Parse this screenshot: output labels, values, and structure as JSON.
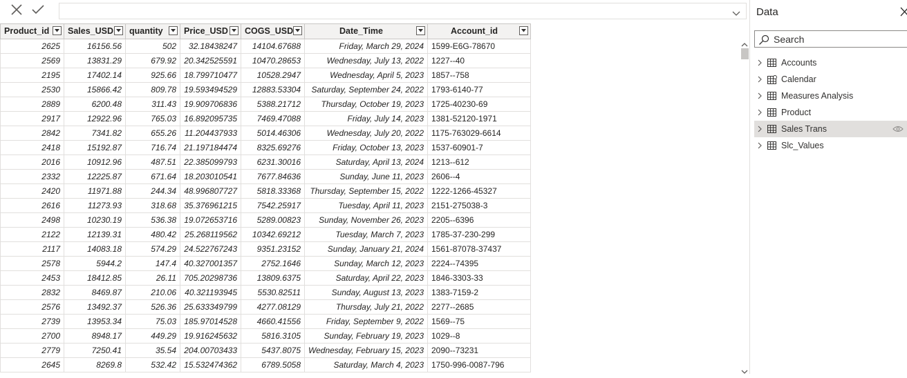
{
  "data_pane": {
    "title": "Data",
    "search_placeholder": "Search",
    "items": [
      {
        "label": "Accounts",
        "icon": "table-icon",
        "selected": false
      },
      {
        "label": "Calendar",
        "icon": "calendar-table-icon",
        "selected": false
      },
      {
        "label": "Measures Analysis",
        "icon": "table-icon",
        "selected": false
      },
      {
        "label": "Product",
        "icon": "table-icon",
        "selected": false
      },
      {
        "label": "Sales Trans",
        "icon": "table-icon",
        "selected": true
      },
      {
        "label": "Slc_Values",
        "icon": "table-icon",
        "selected": false
      }
    ]
  },
  "grid": {
    "columns": [
      "Product_id",
      "Sales_USD",
      "quantity",
      "Price_USD",
      "COGS_USD",
      "Date_Time",
      "Account_id"
    ],
    "rows": [
      [
        "2625",
        "16156.56",
        "502",
        "32.18438247",
        "14104.67688",
        "Friday, March 29, 2024",
        "1599-E6G-78670"
      ],
      [
        "2569",
        "13831.29",
        "679.92",
        "20.342525591",
        "10470.28653",
        "Wednesday, July 13, 2022",
        "1227--40"
      ],
      [
        "2195",
        "17402.14",
        "925.66",
        "18.799710477",
        "10528.2947",
        "Wednesday, April 5, 2023",
        "1857--758"
      ],
      [
        "2530",
        "15866.42",
        "809.78",
        "19.593494529",
        "12883.53304",
        "Saturday, September 24, 2022",
        "1793-6140-77"
      ],
      [
        "2889",
        "6200.48",
        "311.43",
        "19.909706836",
        "5388.21712",
        "Thursday, October 19, 2023",
        "1725-40230-69"
      ],
      [
        "2917",
        "12922.96",
        "765.03",
        "16.892095735",
        "7469.47088",
        "Friday, July 14, 2023",
        "1381-52120-1971"
      ],
      [
        "2842",
        "7341.82",
        "655.26",
        "11.204437933",
        "5014.46306",
        "Wednesday, July 20, 2022",
        "1175-763029-6614"
      ],
      [
        "2418",
        "15192.87",
        "716.74",
        "21.197184474",
        "8325.69276",
        "Friday, October 13, 2023",
        "1537-60901-7"
      ],
      [
        "2016",
        "10912.96",
        "487.51",
        "22.385099793",
        "6231.30016",
        "Saturday, April 13, 2024",
        "1213--612"
      ],
      [
        "2332",
        "12225.87",
        "671.64",
        "18.203010541",
        "7677.84636",
        "Sunday, June 11, 2023",
        "2606--4"
      ],
      [
        "2420",
        "11971.88",
        "244.34",
        "48.996807727",
        "5818.33368",
        "Thursday, September 15, 2022",
        "1222-1266-45327"
      ],
      [
        "2616",
        "11273.93",
        "318.68",
        "35.376961215",
        "7542.25917",
        "Tuesday, April 11, 2023",
        "2151-275038-3"
      ],
      [
        "2498",
        "10230.19",
        "536.38",
        "19.072653716",
        "5289.00823",
        "Sunday, November 26, 2023",
        "2205--6396"
      ],
      [
        "2122",
        "12139.31",
        "480.42",
        "25.268119562",
        "10342.69212",
        "Tuesday, March 7, 2023",
        "1785-37-230-299"
      ],
      [
        "2117",
        "14083.18",
        "574.29",
        "24.522767243",
        "9351.23152",
        "Sunday, January 21, 2024",
        "1561-87078-37437"
      ],
      [
        "2578",
        "5944.2",
        "147.4",
        "40.327001357",
        "2752.1646",
        "Sunday, March 12, 2023",
        "2224--74395"
      ],
      [
        "2453",
        "18412.85",
        "26.11",
        "705.20298736",
        "13809.6375",
        "Saturday, April 22, 2023",
        "1846-3303-33"
      ],
      [
        "2832",
        "8469.87",
        "210.06",
        "40.321193945",
        "5530.82511",
        "Sunday, August 13, 2023",
        "1383-7159-2"
      ],
      [
        "2576",
        "13492.37",
        "526.36",
        "25.633349799",
        "4277.08129",
        "Thursday, July 21, 2022",
        "2277--2685"
      ],
      [
        "2739",
        "13953.34",
        "75.03",
        "185.97014528",
        "4660.41556",
        "Friday, September 9, 2022",
        "1569--75"
      ],
      [
        "2700",
        "8948.17",
        "449.29",
        "19.916245632",
        "5816.3105",
        "Sunday, February 19, 2023",
        "1029--8"
      ],
      [
        "2779",
        "7250.41",
        "35.54",
        "204.00703433",
        "5437.8075",
        "Wednesday, February 15, 2023",
        "2090--73231"
      ],
      [
        "2645",
        "8269.8",
        "532.42",
        "15.532474362",
        "6789.5058",
        "Saturday, March 4, 2023",
        "1750-996-0087-796"
      ]
    ]
  }
}
